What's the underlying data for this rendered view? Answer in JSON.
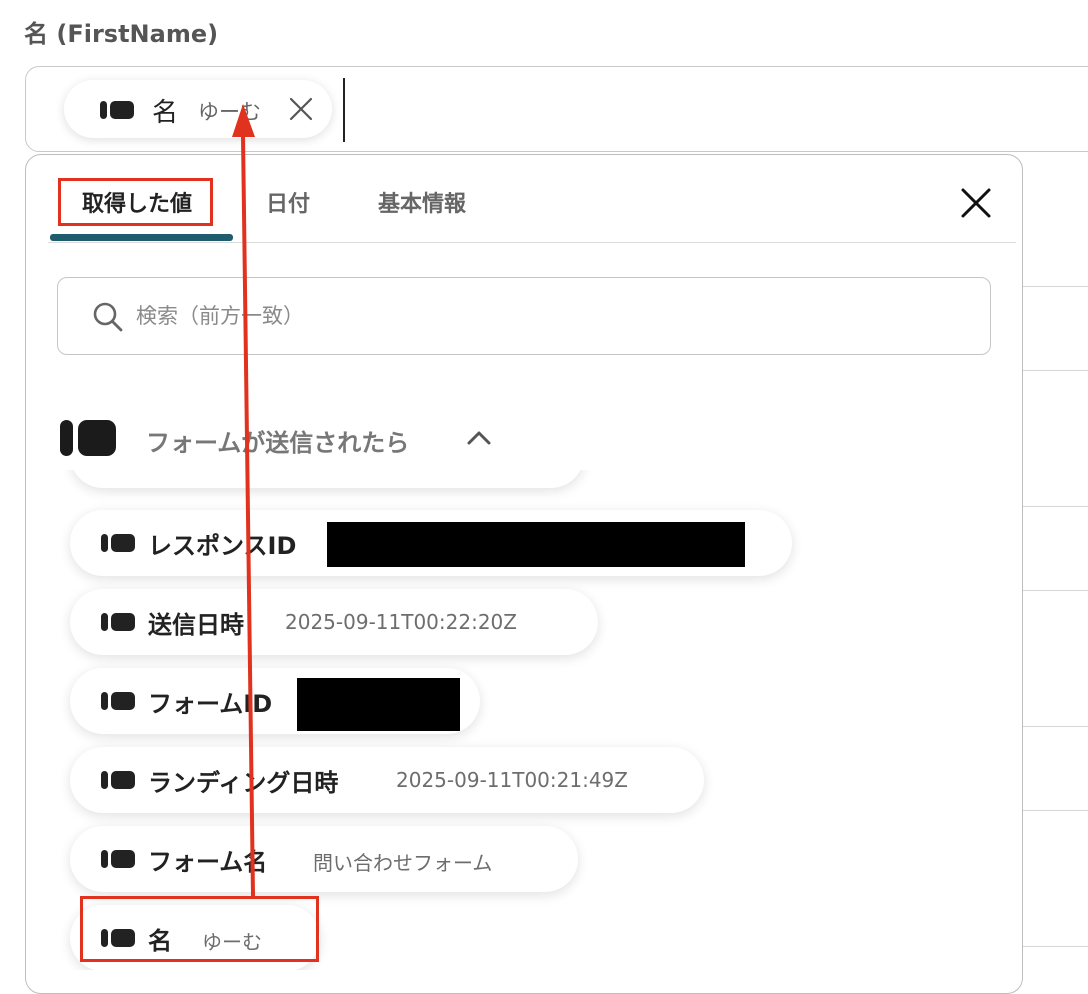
{
  "field": {
    "label": "名 (FirstName)"
  },
  "token": {
    "name": "名",
    "value": "ゆーむ"
  },
  "tabs": [
    {
      "label": "取得した値",
      "active": true
    },
    {
      "label": "日付",
      "active": false
    },
    {
      "label": "基本情報",
      "active": false
    }
  ],
  "search": {
    "placeholder": "検索（前方一致）"
  },
  "section": {
    "title": "フォームが送信されたら"
  },
  "items": [
    {
      "label": "レスポンスID",
      "value": ""
    },
    {
      "label": "送信日時",
      "value": "2025-09-11T00:22:20Z"
    },
    {
      "label": "フォームID",
      "value": ""
    },
    {
      "label": "ランディング日時",
      "value": "2025-09-11T00:21:49Z"
    },
    {
      "label": "フォーム名",
      "value": "問い合わせフォーム"
    },
    {
      "label": "名",
      "value": "ゆーむ"
    }
  ],
  "colors": {
    "accent": "#1f5d6e",
    "highlight": "#e0321f"
  }
}
